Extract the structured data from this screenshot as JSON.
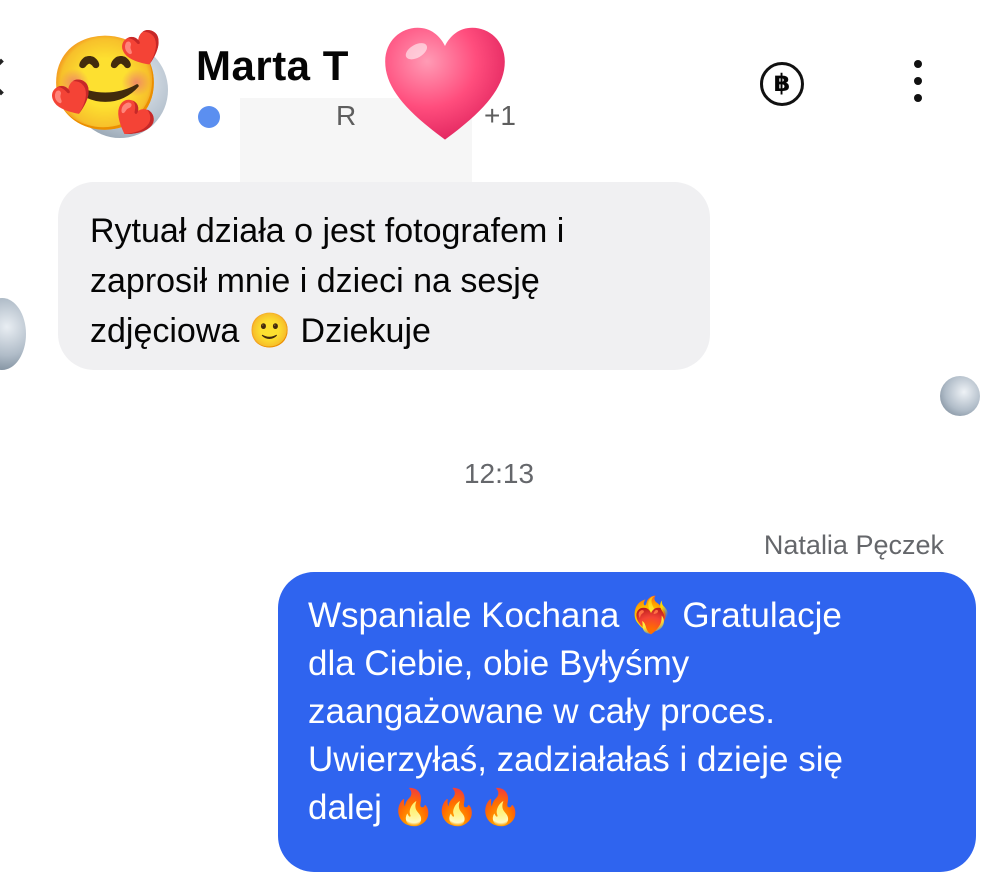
{
  "header": {
    "contact_name": "Marta T",
    "status_fragment": "R",
    "status_extra": "+1",
    "avatar_emoji": "🥰",
    "currency_symbol": "฿",
    "icons": [
      "back-chevron-icon",
      "currency-icon",
      "more-options-icon",
      "heart-sticker"
    ]
  },
  "messages": [
    {
      "direction": "incoming",
      "text": "Rytuał działa o jest fotografem i\nzaprosił mnie i dzieci na sesję\nzdjęciowa 🙂 Dziekuje"
    },
    {
      "direction": "outgoing",
      "timestamp": "12:13",
      "sender": "Natalia Pęczek",
      "text": "Wspaniale Kochana ❤️‍🔥 Gratulacje\ndla Ciebie, obie Byłyśmy\nzaangażowane w cały proces.\nUwierzyłaś, zadziałałaś i dzieje się\ndalej 🔥🔥🔥"
    }
  ],
  "colors": {
    "outgoing_bubble": "#2f64ef",
    "incoming_bubble": "#f0f0f2",
    "status_dot": "#5b8ff0",
    "sticker_heart": "#ff4d7d"
  }
}
